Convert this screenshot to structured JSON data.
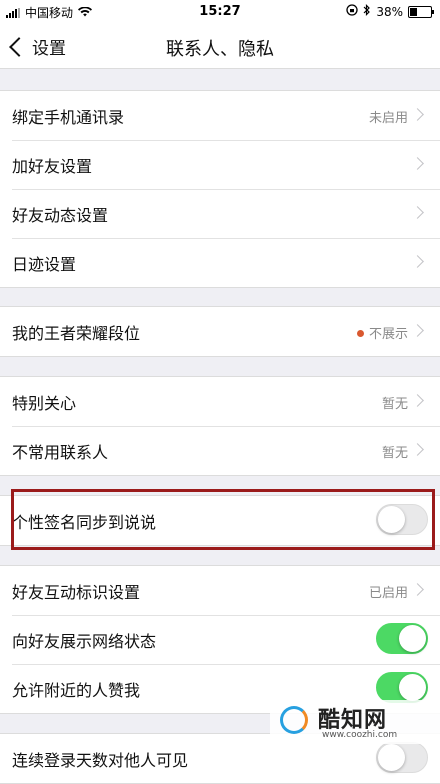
{
  "status": {
    "carrier": "中国移动",
    "time": "15:27",
    "battery": "38%",
    "battery_level": 0.38
  },
  "nav": {
    "back_label": "设置",
    "title": "联系人、隐私"
  },
  "section1": [
    {
      "label": "绑定手机通讯录",
      "value": "未启用"
    },
    {
      "label": "加好友设置",
      "value": ""
    },
    {
      "label": "好友动态设置",
      "value": ""
    },
    {
      "label": "日迹设置",
      "value": ""
    }
  ],
  "section2": [
    {
      "label": "我的王者荣耀段位",
      "value": "不展示",
      "dot_color": "#d9582f"
    }
  ],
  "section3": [
    {
      "label": "特别关心",
      "value": "暂无"
    },
    {
      "label": "不常用联系人",
      "value": "暂无"
    }
  ],
  "section4": [
    {
      "label": "个性签名同步到说说",
      "toggle_on": false
    }
  ],
  "section5": [
    {
      "label": "好友互动标识设置",
      "value": "已启用"
    },
    {
      "label": "向好友展示网络状态",
      "toggle_on": true
    },
    {
      "label": "允许附近的人赞我",
      "toggle_on": true
    }
  ],
  "section6": [
    {
      "label": "连续登录天数对他人可见",
      "toggle_on": false
    }
  ],
  "watermark": {
    "name": "酷知网",
    "url": "www.coozhi.com"
  },
  "colors": {
    "toggle_on": "#4cd964",
    "highlight_border": "#9b1b1b",
    "background": "#efeff4"
  }
}
